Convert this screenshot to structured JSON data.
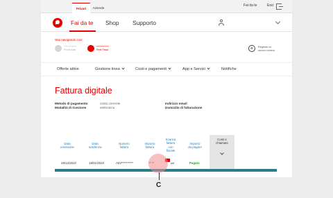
{
  "topbar": {
    "tab_privati": "Privati",
    "tab_aziende": "Aziende",
    "link_fai_da_te": "Fai da te",
    "link_esci": "Esci"
  },
  "nav": {
    "items": [
      "Fai da te",
      "Shop",
      "Supporto"
    ]
  },
  "browsing": {
    "label": "Stai navigando con:",
    "lines": [
      {
        "number": "***********",
        "sub": "Prova Adsl"
      },
      {
        "number": "***********",
        "sub": "Rete Fissa"
      }
    ],
    "register_text_1": "Registra un",
    "register_text_2": "nuovo numero"
  },
  "subnav": {
    "items": [
      "Offerte attive",
      "Gestione linea",
      "Costi e pagamenti",
      "App e Servizi",
      "Notifiche"
    ]
  },
  "page": {
    "title": "Fattura digitale",
    "payment_label": "Metodo di pagamento",
    "payment_value": "conto corrente",
    "receipt_label": "Modalità di ricezione",
    "receipt_value": "elettronica",
    "email_label": "Indirizzo email",
    "billing_label": "Domicilio di fatturazione"
  },
  "table": {
    "headers": [
      [
        "Data",
        "emissione"
      ],
      [
        "Data",
        "scadenza"
      ],
      [
        "Numero",
        "fattura"
      ],
      [
        "Importo",
        "fattura"
      ],
      [
        "Scarica",
        "fattura",
        "con",
        "fiscale"
      ],
      [
        "Importo",
        "da pagare"
      ]
    ],
    "cost_header_1": "Costi e",
    "cost_header_2": "chiamate",
    "row": {
      "emission": "29/12/2022",
      "due": "18/01/2023",
      "number": "A02**********",
      "amount": "** **",
      "download": "pdf",
      "status": "Pagato"
    }
  },
  "marker": {
    "label": "C"
  },
  "colors": {
    "brand_red": "#e60000",
    "link_blue": "#1f80c0",
    "teal_bar": "#2a7c8a",
    "paid_green": "#2c9c2c"
  }
}
